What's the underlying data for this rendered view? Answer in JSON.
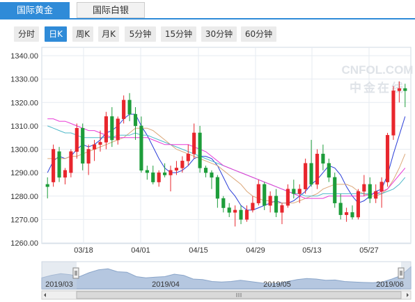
{
  "tabs": [
    {
      "label": "国际黄金",
      "active": true
    },
    {
      "label": "国际白银",
      "active": false
    }
  ],
  "periods": [
    {
      "label": "分时",
      "active": false
    },
    {
      "label": "日K",
      "active": true
    },
    {
      "label": "周K",
      "active": false
    },
    {
      "label": "月K",
      "active": false
    },
    {
      "label": "5分钟",
      "active": false
    },
    {
      "label": "15分钟",
      "active": false
    },
    {
      "label": "30分钟",
      "active": false
    },
    {
      "label": "60分钟",
      "active": false
    }
  ],
  "watermark": {
    "brand": "CNFOL.COM",
    "cn": "中金在线"
  },
  "colors": {
    "up": "#e8262d",
    "down": "#1d9d3a",
    "accent": "#2f8bd8",
    "ma_pink": "#e83ad6",
    "ma_blue": "#2b3ed8",
    "ma_cyan": "#4fb8c9",
    "ma_tan": "#dca87a"
  },
  "chart_data": {
    "type": "candlestick",
    "ylim": [
      1260,
      1340
    ],
    "y_ticks": [
      "1340.00",
      "1330.00",
      "1320.00",
      "1310.00",
      "1300.00",
      "1290.00",
      "1280.00",
      "1270.00",
      "1260.00"
    ],
    "x_ticks": [
      "03/18",
      "04/01",
      "04/15",
      "04/29",
      "05/13",
      "05/27"
    ],
    "candles": [
      [
        1285,
        1288,
        1279,
        1284
      ],
      [
        1286,
        1302,
        1284,
        1300
      ],
      [
        1299,
        1301,
        1286,
        1288
      ],
      [
        1288,
        1292,
        1285,
        1291
      ],
      [
        1290,
        1300,
        1288,
        1299
      ],
      [
        1299,
        1311,
        1296,
        1309
      ],
      [
        1309,
        1311,
        1291,
        1294
      ],
      [
        1294,
        1302,
        1289,
        1300
      ],
      [
        1300,
        1304,
        1295,
        1302
      ],
      [
        1302,
        1308,
        1299,
        1303
      ],
      [
        1303,
        1316,
        1300,
        1314
      ],
      [
        1314,
        1318,
        1301,
        1304
      ],
      [
        1304,
        1314,
        1302,
        1313
      ],
      [
        1313,
        1323,
        1311,
        1321
      ],
      [
        1321,
        1324,
        1312,
        1315
      ],
      [
        1315,
        1318,
        1304,
        1310
      ],
      [
        1310,
        1314,
        1290,
        1291
      ],
      [
        1291,
        1293,
        1287,
        1290
      ],
      [
        1290,
        1293,
        1285,
        1286
      ],
      [
        1286,
        1291,
        1284,
        1290
      ],
      [
        1290,
        1294,
        1288,
        1289
      ],
      [
        1289,
        1293,
        1282,
        1291
      ],
      [
        1291,
        1295,
        1289,
        1292
      ],
      [
        1292,
        1297,
        1290,
        1295
      ],
      [
        1295,
        1302,
        1293,
        1298
      ],
      [
        1298,
        1311,
        1296,
        1307
      ],
      [
        1307,
        1310,
        1290,
        1292
      ],
      [
        1292,
        1293,
        1288,
        1290
      ],
      [
        1290,
        1291,
        1283,
        1288
      ],
      [
        1288,
        1289,
        1275,
        1279
      ],
      [
        1279,
        1280,
        1273,
        1275
      ],
      [
        1275,
        1277,
        1271,
        1273
      ],
      [
        1273,
        1276,
        1267,
        1274
      ],
      [
        1274,
        1276,
        1268,
        1270
      ],
      [
        1270,
        1276,
        1269,
        1274
      ],
      [
        1274,
        1280,
        1273,
        1277
      ],
      [
        1277,
        1287,
        1276,
        1285
      ],
      [
        1285,
        1286,
        1274,
        1276
      ],
      [
        1276,
        1282,
        1273,
        1280
      ],
      [
        1280,
        1283,
        1271,
        1273
      ],
      [
        1273,
        1277,
        1268,
        1276
      ],
      [
        1276,
        1285,
        1275,
        1283
      ],
      [
        1283,
        1287,
        1279,
        1281
      ],
      [
        1281,
        1285,
        1277,
        1283
      ],
      [
        1283,
        1296,
        1281,
        1294
      ],
      [
        1294,
        1304,
        1284,
        1285
      ],
      [
        1285,
        1300,
        1283,
        1298
      ],
      [
        1298,
        1302,
        1291,
        1294
      ],
      [
        1294,
        1296,
        1286,
        1288
      ],
      [
        1288,
        1290,
        1275,
        1277
      ],
      [
        1277,
        1281,
        1270,
        1272
      ],
      [
        1272,
        1275,
        1269,
        1273
      ],
      [
        1273,
        1276,
        1270,
        1271
      ],
      [
        1271,
        1283,
        1270,
        1282
      ],
      [
        1282,
        1289,
        1280,
        1285
      ],
      [
        1285,
        1288,
        1277,
        1279
      ],
      [
        1279,
        1285,
        1277,
        1282
      ],
      [
        1282,
        1288,
        1275,
        1286
      ],
      [
        1286,
        1307,
        1284,
        1306
      ],
      [
        1306,
        1327,
        1304,
        1325
      ],
      [
        1325,
        1329,
        1320,
        1326
      ],
      [
        1326,
        1328,
        1318,
        1325
      ]
    ],
    "ma_series": [
      {
        "color_key": "ma_blue",
        "values": [
          1290,
          1295,
          1297,
          1296,
          1297,
          1300,
          1302,
          1301,
          1302,
          1304,
          1307,
          1308,
          1310,
          1313,
          1315,
          1315,
          1310,
          1306,
          1301,
          1296,
          1292,
          1290,
          1290,
          1291,
          1293,
          1296,
          1297,
          1297,
          1296,
          1293,
          1288,
          1283,
          1280,
          1276,
          1274,
          1274,
          1275,
          1276,
          1277,
          1278,
          1277,
          1277,
          1278,
          1280,
          1282,
          1285,
          1287,
          1290,
          1293,
          1292,
          1289,
          1284,
          1280,
          1277,
          1278,
          1280,
          1282,
          1283,
          1289,
          1298,
          1306,
          1314
        ]
      },
      {
        "color_key": "ma_tan",
        "values": [
          1296,
          1296,
          1296,
          1296,
          1297,
          1297,
          1298,
          1299,
          1300,
          1301,
          1302,
          1303,
          1304,
          1305,
          1307,
          1309,
          1309,
          1309,
          1308,
          1306,
          1304,
          1302,
          1300,
          1299,
          1298,
          1297,
          1296,
          1295,
          1294,
          1293,
          1291,
          1289,
          1287,
          1285,
          1282,
          1280,
          1279,
          1278,
          1278,
          1277,
          1277,
          1277,
          1277,
          1278,
          1279,
          1280,
          1281,
          1283,
          1284,
          1285,
          1285,
          1285,
          1284,
          1282,
          1281,
          1280,
          1280,
          1281,
          1283,
          1287,
          1292,
          1298
        ]
      },
      {
        "color_key": "ma_cyan",
        "values": [
          1310,
          1309,
          1308,
          1307,
          1307,
          1306,
          1305,
          1305,
          1305,
          1305,
          1305,
          1305,
          1306,
          1306,
          1306,
          1307,
          1306,
          1306,
          1305,
          1304,
          1303,
          1302,
          1301,
          1300,
          1299,
          1298,
          1297,
          1296,
          1295,
          1294,
          1293,
          1292,
          1291,
          1290,
          1289,
          1288,
          1287,
          1286,
          1285,
          1284,
          1283,
          1282,
          1281,
          1281,
          1280,
          1280,
          1280,
          1281,
          1281,
          1281,
          1281,
          1281,
          1281,
          1281,
          1281,
          1281,
          1281,
          1281,
          1282,
          1283,
          1285,
          1288
        ]
      },
      {
        "color_key": "ma_pink",
        "values": [
          1313,
          1313,
          1312,
          1312,
          1311,
          1310,
          1309,
          1308,
          1308,
          1307,
          1306,
          1305,
          1305,
          1305,
          1305,
          1305,
          1305,
          1305,
          1304,
          1303,
          1302,
          1302,
          1302,
          1302,
          1302,
          1301,
          1300,
          1299,
          1297,
          1295,
          1293,
          1292,
          1291,
          1290,
          1289,
          1288,
          1287,
          1286,
          1285,
          1284,
          1283,
          1282,
          1281,
          1280,
          1279,
          1279,
          1279,
          1279,
          1280,
          1280,
          1280,
          1280,
          1280,
          1280,
          1280,
          1281,
          1281,
          1282,
          1283,
          1286,
          1289,
          1292
        ]
      }
    ]
  },
  "navigator": {
    "labels": [
      "2019/03",
      "2019/04",
      "2019/05",
      "2019/06"
    ],
    "series": [
      0.45,
      0.55,
      0.62,
      0.58,
      0.5,
      0.66,
      0.78,
      0.82,
      0.7,
      0.68,
      0.5,
      0.45,
      0.48,
      0.5,
      0.6,
      0.55,
      0.4,
      0.38,
      0.3,
      0.28,
      0.3,
      0.35,
      0.3,
      0.25,
      0.2,
      0.22,
      0.3,
      0.38,
      0.42,
      0.4,
      0.35,
      0.36,
      0.3,
      0.28,
      0.26,
      0.25,
      0.28,
      0.4,
      0.55,
      0.9
    ]
  }
}
